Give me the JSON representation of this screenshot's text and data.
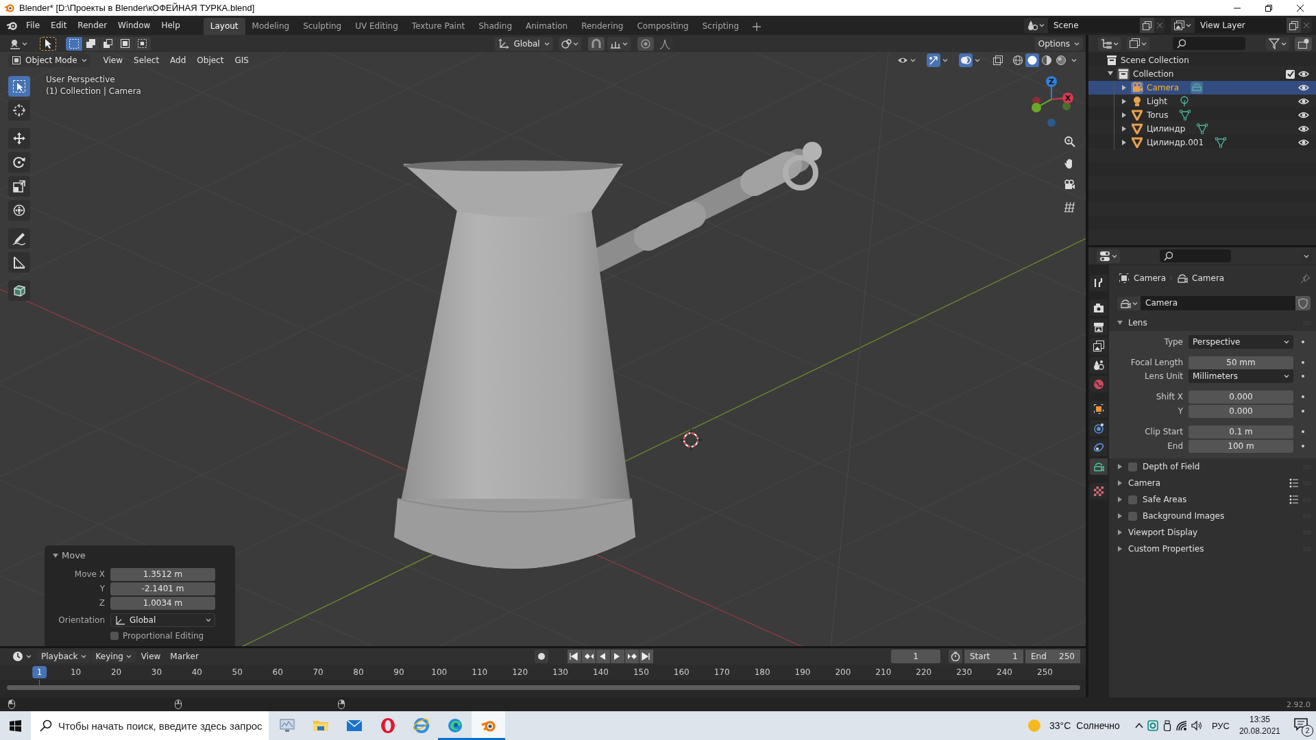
{
  "window": {
    "title": "Blender* [D:\\Проекты в Blender\\кОФЕЙНАЯ ТУРКА.blend]"
  },
  "topbar": {
    "menu": [
      "File",
      "Edit",
      "Render",
      "Window",
      "Help"
    ],
    "workspaces": [
      {
        "label": "Layout",
        "selected": true
      },
      {
        "label": "Modeling",
        "selected": false
      },
      {
        "label": "Sculpting",
        "selected": false
      },
      {
        "label": "UV Editing",
        "selected": false
      },
      {
        "label": "Texture Paint",
        "selected": false
      },
      {
        "label": "Shading",
        "selected": false
      },
      {
        "label": "Animation",
        "selected": false
      },
      {
        "label": "Rendering",
        "selected": false
      },
      {
        "label": "Compositing",
        "selected": false
      },
      {
        "label": "Scripting",
        "selected": false
      }
    ],
    "scene": "Scene",
    "view_layer": "View Layer"
  },
  "tool_header": {
    "select_modes": [
      {
        "kind": "set",
        "selected": true
      },
      {
        "kind": "extend",
        "selected": false
      },
      {
        "kind": "subtract",
        "selected": false
      },
      {
        "kind": "invert",
        "selected": false
      },
      {
        "kind": "intersect",
        "selected": false
      }
    ],
    "orientation": "Global",
    "options": "Options"
  },
  "viewport": {
    "mode": "Object Mode",
    "menu": [
      "View",
      "Select",
      "Add",
      "Object",
      "GIS"
    ],
    "info": [
      "User Perspective",
      "(1) Collection | Camera"
    ],
    "gizmo_labels": [
      "Z",
      "X"
    ],
    "shading": [
      {
        "kind": "wireframe",
        "selected": false
      },
      {
        "kind": "solid",
        "selected": true
      },
      {
        "kind": "material",
        "selected": false
      },
      {
        "kind": "rendered",
        "selected": false
      }
    ],
    "tools": [
      {
        "kind": "select",
        "selected": true
      },
      {
        "kind": "cursor",
        "selected": false
      },
      {
        "kind": "move",
        "selected": false
      },
      {
        "kind": "rotate",
        "selected": false
      },
      {
        "kind": "scale",
        "selected": false
      },
      {
        "kind": "transform",
        "selected": false
      },
      {
        "kind": "annotate",
        "selected": false
      },
      {
        "kind": "measure",
        "selected": false
      },
      {
        "kind": "add-cube",
        "selected": false
      }
    ]
  },
  "operator_panel": {
    "title": "Move",
    "expanded": true,
    "fields": [
      {
        "label": "Move X",
        "value": "1.3512 m"
      },
      {
        "label": "Y",
        "value": "-2.1401 m"
      },
      {
        "label": "Z",
        "value": "1.0034 m"
      }
    ],
    "orientation": {
      "label": "Orientation",
      "value": "Global"
    },
    "proportional": {
      "label": "Proportional Editing",
      "checked": false
    }
  },
  "outliner": {
    "root": "Scene Collection",
    "collection": {
      "name": "Collection",
      "expanded": true,
      "checked": true,
      "children": [
        {
          "name": "Camera",
          "kind": "camera",
          "selected": true,
          "visible": true
        },
        {
          "name": "Light",
          "kind": "light",
          "selected": false,
          "visible": true
        },
        {
          "name": "Torus",
          "kind": "mesh",
          "selected": false,
          "visible": true
        },
        {
          "name": "Цилиндр",
          "kind": "mesh",
          "selected": false,
          "visible": true
        },
        {
          "name": "Цилиндр.001",
          "kind": "mesh",
          "selected": false,
          "visible": true
        }
      ]
    }
  },
  "properties": {
    "tabs": [
      {
        "kind": "tool",
        "selected": false
      },
      {
        "kind": "render",
        "selected": false
      },
      {
        "kind": "output",
        "selected": false
      },
      {
        "kind": "view-layer",
        "selected": false
      },
      {
        "kind": "scene",
        "selected": false
      },
      {
        "kind": "world",
        "selected": false
      },
      {
        "kind": "object",
        "selected": false
      },
      {
        "kind": "physics",
        "selected": false
      },
      {
        "kind": "constraints",
        "selected": false
      },
      {
        "kind": "camera-data",
        "selected": true
      },
      {
        "kind": "texture",
        "selected": false
      }
    ],
    "breadcrumb": [
      "Camera",
      "Camera"
    ],
    "datablock": "Camera",
    "lens": {
      "title": "Lens",
      "expanded": true,
      "rows": [
        {
          "label": "Type",
          "value": "Perspective",
          "kind": "dropdown"
        },
        {
          "label": "Focal Length",
          "value": "50 mm",
          "kind": "number"
        },
        {
          "label": "Lens Unit",
          "value": "Millimeters",
          "kind": "dropdown"
        },
        {
          "label": "Shift X",
          "value": "0.000",
          "kind": "number"
        },
        {
          "label": "Y",
          "value": "0.000",
          "kind": "number"
        },
        {
          "label": "Clip Start",
          "value": "0.1 m",
          "kind": "number"
        },
        {
          "label": "End",
          "value": "100 m",
          "kind": "number"
        }
      ]
    },
    "panels": [
      {
        "title": "Depth of Field",
        "kind": "toggle",
        "checked": false,
        "presets": false
      },
      {
        "title": "Camera",
        "kind": "plain",
        "presets": true
      },
      {
        "title": "Safe Areas",
        "kind": "toggle",
        "checked": false,
        "presets": true
      },
      {
        "title": "Background Images",
        "kind": "toggle",
        "checked": false,
        "presets": false
      },
      {
        "title": "Viewport Display",
        "kind": "plain",
        "presets": false
      },
      {
        "title": "Custom Properties",
        "kind": "plain",
        "presets": false
      }
    ]
  },
  "timeline": {
    "menu": [
      "Playback",
      "Keying",
      "View",
      "Marker"
    ],
    "current_frame": "1",
    "start_label": "Start",
    "start": "1",
    "end_label": "End",
    "end": "250",
    "ticks": [
      "1",
      "10",
      "20",
      "30",
      "40",
      "50",
      "60",
      "70",
      "80",
      "90",
      "100",
      "110",
      "120",
      "130",
      "140",
      "150",
      "160",
      "170",
      "180",
      "190",
      "200",
      "210",
      "220",
      "230",
      "240",
      "250"
    ]
  },
  "status_bar": {
    "version": "2.92.0"
  },
  "taskbar": {
    "search": {
      "placeholder": "Чтобы начать поиск, введите здесь запрос"
    },
    "apps": [
      {
        "kind": "task-view",
        "running": false,
        "selected": false
      },
      {
        "kind": "folder",
        "running": false,
        "selected": false
      },
      {
        "kind": "mail",
        "running": false,
        "selected": false
      },
      {
        "kind": "opera",
        "running": false,
        "selected": false
      },
      {
        "kind": "ie",
        "running": false,
        "selected": false
      },
      {
        "kind": "edge",
        "running": true,
        "selected": false
      },
      {
        "kind": "blender",
        "running": true,
        "selected": true
      }
    ],
    "temperature": "33°C",
    "weather": "Солнечно",
    "language": "РУС",
    "time": "13:35",
    "date": "20.08.2021",
    "notifications": "2"
  }
}
